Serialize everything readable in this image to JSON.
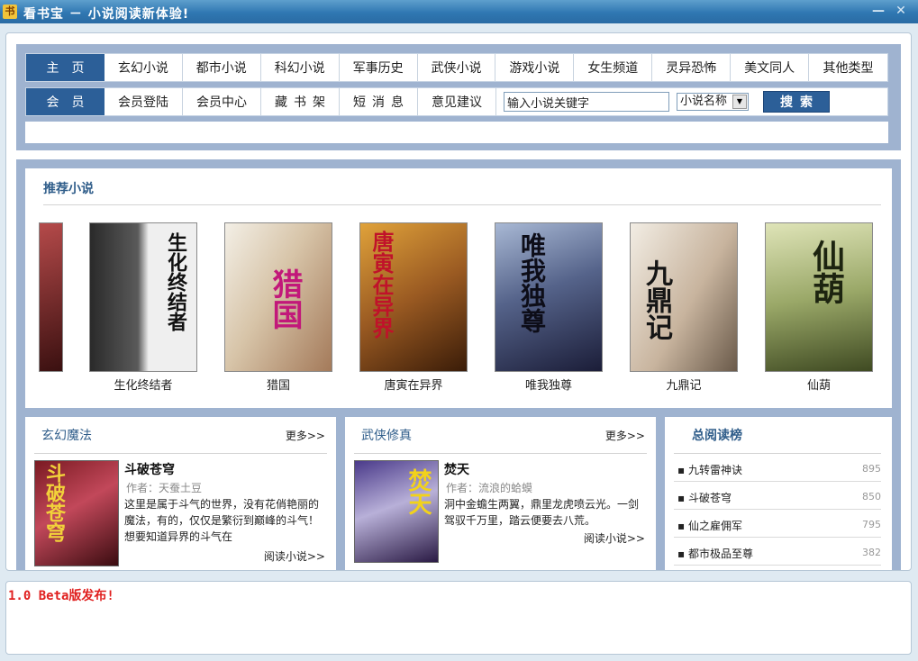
{
  "window": {
    "app_icon": "书",
    "title": "看书宝 － 小说阅读新体验!",
    "minimize": "—",
    "close": "✕"
  },
  "nav": {
    "row1_head": "主页",
    "row1": [
      "玄幻小说",
      "都市小说",
      "科幻小说",
      "军事历史",
      "武侠小说",
      "游戏小说",
      "女生频道",
      "灵异恐怖",
      "美文同人",
      "其他类型"
    ],
    "row2_head": "会员",
    "row2": [
      "会员登陆",
      "会员中心",
      "藏书架",
      "短消息",
      "意见建议"
    ],
    "search_value": "输入小说关键字",
    "search_type": "小说名称",
    "search_button": "搜索"
  },
  "recommend": {
    "title": "推荐小说",
    "books": [
      {
        "title": "生化终结者",
        "cover_text": "生化终结者",
        "cover_colors": [
          "#efefef",
          "#2a2a2a"
        ]
      },
      {
        "title": "猎国",
        "cover_text": "猎国",
        "cover_colors": [
          "#e8e2d8",
          "#a47a5a"
        ]
      },
      {
        "title": "唐寅在异界",
        "cover_text": "唐寅在异界",
        "cover_colors": [
          "#c98a2a",
          "#4a2a10"
        ]
      },
      {
        "title": "唯我独尊",
        "cover_text": "唯我独尊",
        "cover_colors": [
          "#8aa0c0",
          "#1f2240"
        ]
      },
      {
        "title": "九鼎记",
        "cover_text": "九鼎记",
        "cover_colors": [
          "#efe9df",
          "#6a5a4a"
        ]
      },
      {
        "title": "仙葫",
        "cover_text": "仙葫",
        "cover_colors": [
          "#c7cf9a",
          "#3f4a22"
        ]
      }
    ]
  },
  "panels": {
    "xuanhuan": {
      "title": "玄幻魔法",
      "more": "更多>>",
      "book_title": "斗破苍穹",
      "author_label": "作者：",
      "author": "天蚕土豆",
      "desc": "这里是属于斗气的世界，没有花俏艳丽的魔法，有的，仅仅是繁衍到巅峰的斗气！想要知道异界的斗气在",
      "read": "阅读小说>>",
      "cover_text": "斗破苍穹"
    },
    "wuxia": {
      "title": "武侠修真",
      "more": "更多>>",
      "book_title": "焚天",
      "author_label": "作者：",
      "author": "流浪的蛤蟆",
      "desc": "洞中金蟾生两翼，鼎里龙虎喷云光。一剑驾驭千万里，踏云便要去八荒。",
      "read": "阅读小说>>",
      "cover_text": "焚天"
    },
    "ranking": {
      "title": "总阅读榜",
      "items": [
        {
          "name": "九转雷神诀",
          "count": "895"
        },
        {
          "name": "斗破苍穹",
          "count": "850"
        },
        {
          "name": "仙之雇佣军",
          "count": "795"
        },
        {
          "name": "都市极品至尊",
          "count": "382"
        }
      ]
    }
  },
  "status": {
    "text": "1.0 Beta版发布!"
  }
}
